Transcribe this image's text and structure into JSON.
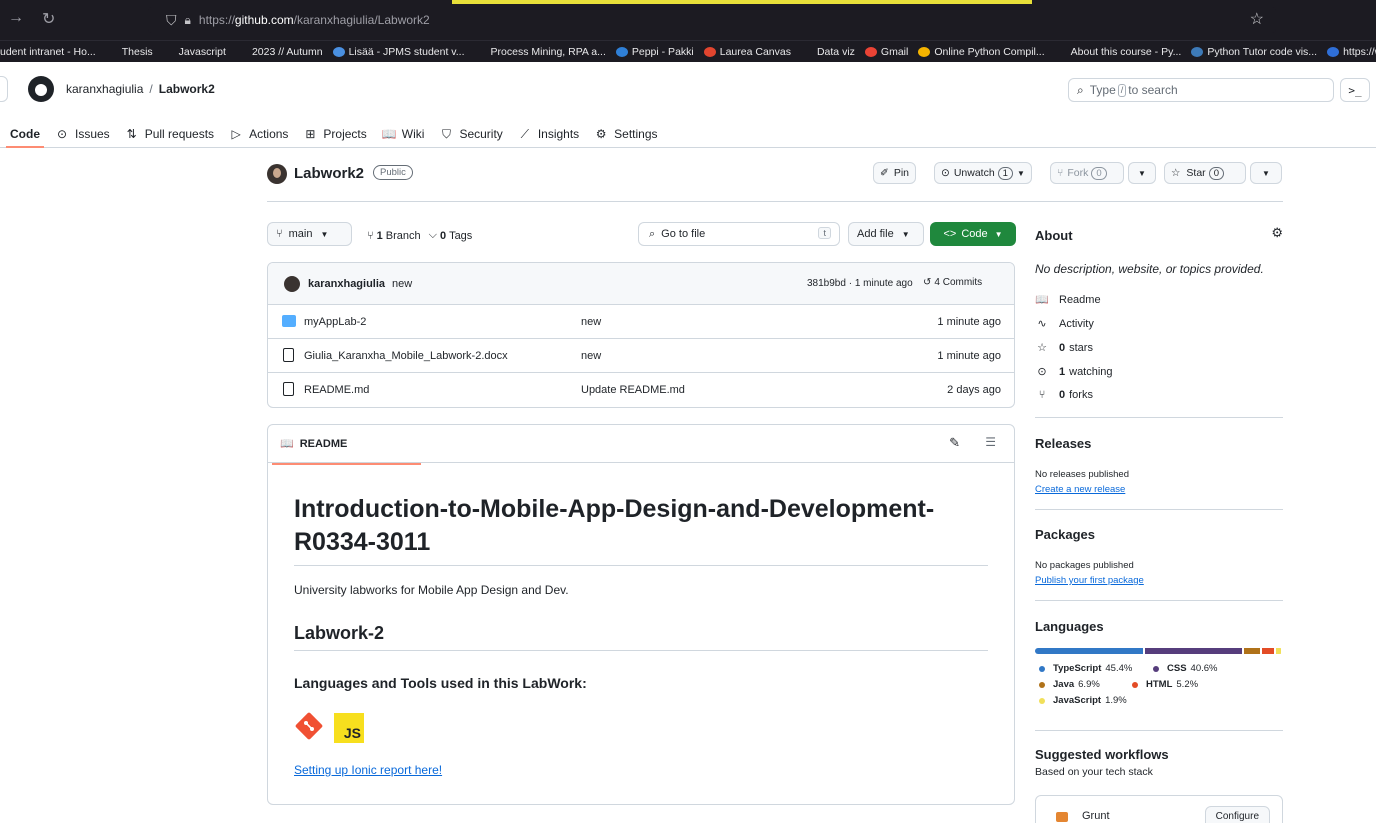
{
  "browser": {
    "url_prefix": "https://",
    "url_host": "github.com",
    "url_path": "/karanxhagiulia/Labwork2",
    "bookmarks": [
      {
        "label": "udent intranet - Ho...",
        "color": "#c9c9cc"
      },
      {
        "label": "Thesis",
        "color": "#c9c9cc"
      },
      {
        "label": "Javascript",
        "color": "#c9c9cc"
      },
      {
        "label": "2023 // Autumn",
        "color": "#c9c9cc"
      },
      {
        "label": "Lisää - JPMS student v...",
        "color": "#4a90e2"
      },
      {
        "label": "Process Mining, RPA a...",
        "color": "#c9c9cc"
      },
      {
        "label": "Peppi - Pakki",
        "color": "#2f80d8"
      },
      {
        "label": "Laurea Canvas",
        "color": "#e2452f"
      },
      {
        "label": "Data viz",
        "color": "#c9c9cc"
      },
      {
        "label": "Gmail",
        "color": "#ea4335"
      },
      {
        "label": "Online Python Compil...",
        "color": "#f5b400"
      },
      {
        "label": "About this course - Py...",
        "color": "#c9c9cc"
      },
      {
        "label": "Python Tutor code vis...",
        "color": "#3d7ab8"
      },
      {
        "label": "https://www.c",
        "color": "#2f6fd8"
      }
    ]
  },
  "header": {
    "owner": "karanxhagiulia",
    "separator": "/",
    "repo": "Labwork2",
    "search_prefix": "Type",
    "search_key": "/",
    "search_suffix": "to search",
    "terminal_label": ">_"
  },
  "tabs": [
    {
      "label": "Code",
      "icon": "<>"
    },
    {
      "label": "Issues",
      "icon": "⊙"
    },
    {
      "label": "Pull requests",
      "icon": "⇅"
    },
    {
      "label": "Actions",
      "icon": "▷"
    },
    {
      "label": "Projects",
      "icon": "⊞"
    },
    {
      "label": "Wiki",
      "icon": "📖"
    },
    {
      "label": "Security",
      "icon": "⛉"
    },
    {
      "label": "Insights",
      "icon": "⟋"
    },
    {
      "label": "Settings",
      "icon": "⚙"
    }
  ],
  "repo": {
    "name": "Labwork2",
    "visibility": "Public",
    "pin_label": "Pin",
    "unwatch_label": "Unwatch",
    "watch_count": "1",
    "fork_label": "Fork",
    "fork_count": "0",
    "star_label": "Star",
    "star_count": "0"
  },
  "files_toolbar": {
    "branch": "main",
    "branch_count": "1",
    "branch_word": "Branch",
    "tag_count": "0",
    "tag_word": "Tags",
    "goto_placeholder": "Go to file",
    "goto_key": "t",
    "add_file": "Add file",
    "code_button": "Code"
  },
  "latest_commit": {
    "author": "karanxhagiulia",
    "message": "new",
    "meta": "381b9bd · 1 minute ago",
    "commits": "4 Commits"
  },
  "files": [
    {
      "name": "myAppLab-2",
      "type": "folder",
      "message": "new",
      "date": "1 minute ago"
    },
    {
      "name": "Giulia_Karanxha_Mobile_Labwork-2.docx",
      "type": "file",
      "message": "new",
      "date": "1 minute ago"
    },
    {
      "name": "README.md",
      "type": "file",
      "message": "Update README.md",
      "date": "2 days ago"
    }
  ],
  "readme": {
    "tab_label": "README",
    "h1": "Introduction-to-Mobile-App-Design-and-Development-R0334-3011",
    "description": "University labworks for Mobile App Design and Dev.",
    "h2": "Labwork-2",
    "h3": "Languages and Tools used in this LabWork:",
    "js_badge": "JS",
    "link": "Setting up Ionic report here!"
  },
  "about": {
    "title": "About",
    "description": "No description, website, or topics provided.",
    "items": [
      {
        "icon": "book-icon",
        "glyph": "📖",
        "bold": "",
        "text": "Readme"
      },
      {
        "icon": "pulse-icon",
        "glyph": "∿",
        "bold": "",
        "text": "Activity"
      },
      {
        "icon": "star-icon",
        "glyph": "☆",
        "bold": "0",
        "text": "stars"
      },
      {
        "icon": "eye-icon",
        "glyph": "⊙",
        "bold": "1",
        "text": "watching"
      },
      {
        "icon": "fork-icon",
        "glyph": "⑂",
        "bold": "0",
        "text": "forks"
      }
    ]
  },
  "releases": {
    "title": "Releases",
    "text": "No releases published",
    "link": "Create a new release"
  },
  "packages": {
    "title": "Packages",
    "text": "No packages published",
    "link": "Publish your first package"
  },
  "languages": {
    "title": "Languages",
    "items": [
      {
        "name": "TypeScript",
        "percent": "45.4%",
        "value": 45.4,
        "color": "#3178c6"
      },
      {
        "name": "CSS",
        "percent": "40.6%",
        "value": 40.6,
        "color": "#563d7c"
      },
      {
        "name": "Java",
        "percent": "6.9%",
        "value": 6.9,
        "color": "#b07219"
      },
      {
        "name": "HTML",
        "percent": "5.2%",
        "value": 5.2,
        "color": "#e34c26"
      },
      {
        "name": "JavaScript",
        "percent": "1.9%",
        "value": 1.9,
        "color": "#f1e05a"
      }
    ]
  },
  "workflows": {
    "title": "Suggested workflows",
    "subtitle": "Based on your tech stack",
    "item_name": "Grunt",
    "configure": "Configure"
  }
}
